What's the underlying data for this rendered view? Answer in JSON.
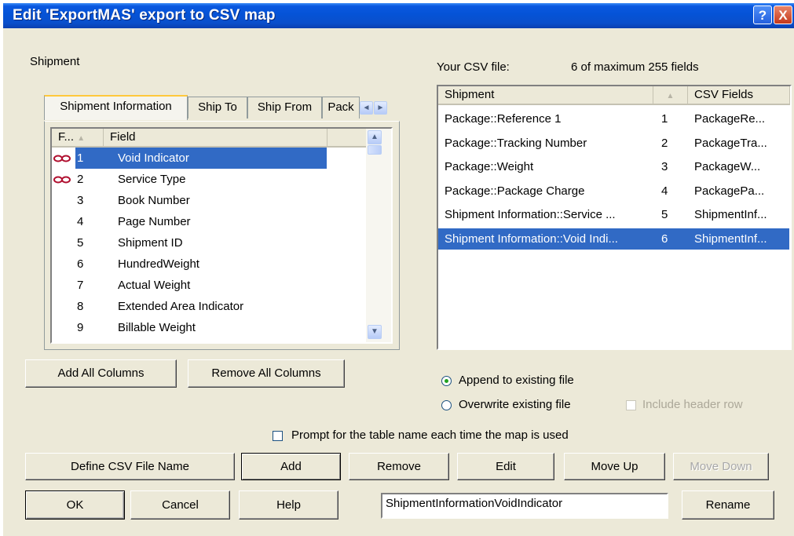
{
  "window": {
    "title": "Edit 'ExportMAS' export to CSV map",
    "help_glyph": "?",
    "close_glyph": "X"
  },
  "left": {
    "group_label": "Shipment",
    "tabs": [
      "Shipment Information",
      "Ship To",
      "Ship From",
      "Pack"
    ],
    "tab_scroll": {
      "left": "◄",
      "right": "►"
    },
    "columns": {
      "num": "F...",
      "field": "Field",
      "sort_glyph": "▲"
    },
    "fields": [
      {
        "num": "1",
        "name": "Void Indicator",
        "linked": true,
        "selected": true
      },
      {
        "num": "2",
        "name": "Service Type",
        "linked": true,
        "selected": false
      },
      {
        "num": "3",
        "name": "Book Number",
        "linked": false,
        "selected": false
      },
      {
        "num": "4",
        "name": "Page Number",
        "linked": false,
        "selected": false
      },
      {
        "num": "5",
        "name": "Shipment ID",
        "linked": false,
        "selected": false
      },
      {
        "num": "6",
        "name": "HundredWeight",
        "linked": false,
        "selected": false
      },
      {
        "num": "7",
        "name": "Actual Weight",
        "linked": false,
        "selected": false
      },
      {
        "num": "8",
        "name": "Extended Area Indicator",
        "linked": false,
        "selected": false
      },
      {
        "num": "9",
        "name": "Billable Weight",
        "linked": false,
        "selected": false
      }
    ],
    "scroll": {
      "up": "▲",
      "down": "▼"
    },
    "add_all_label": "Add All Columns",
    "remove_all_label": "Remove All Columns"
  },
  "right": {
    "csv_label": "Your CSV file:",
    "field_count": "6 of maximum 255 fields",
    "columns": {
      "shipment": "Shipment",
      "sort_glyph": "▲",
      "csv": "CSV Fields"
    },
    "rows": [
      {
        "shipment": "Package::Reference 1",
        "num": "1",
        "csv": "PackageRe...",
        "selected": false
      },
      {
        "shipment": "Package::Tracking Number",
        "num": "2",
        "csv": "PackageTra...",
        "selected": false
      },
      {
        "shipment": "Package::Weight",
        "num": "3",
        "csv": "PackageW...",
        "selected": false
      },
      {
        "shipment": "Package::Package Charge",
        "num": "4",
        "csv": "PackagePa...",
        "selected": false
      },
      {
        "shipment": "Shipment Information::Service ...",
        "num": "5",
        "csv": "ShipmentInf...",
        "selected": false
      },
      {
        "shipment": "Shipment Information::Void Indi...",
        "num": "6",
        "csv": "ShipmentInf...",
        "selected": true
      }
    ],
    "append_label": "Append to existing file",
    "overwrite_label": "Overwrite existing file",
    "include_header_label": "Include header row",
    "append_selected": true
  },
  "prompt_label": "Prompt for the table name each time the map is used",
  "buttons": {
    "define": "Define CSV File Name",
    "add": "Add",
    "remove": "Remove",
    "edit": "Edit",
    "move_up": "Move Up",
    "move_down": "Move Down",
    "ok": "OK",
    "cancel": "Cancel",
    "help": "Help",
    "rename": "Rename"
  },
  "name_input_value": "ShipmentInformationVoidIndicator",
  "colors": {
    "selection": "#316ac5",
    "titlebar": "#0553d6",
    "face": "#ece9d8",
    "link_icon": "#b01030"
  }
}
